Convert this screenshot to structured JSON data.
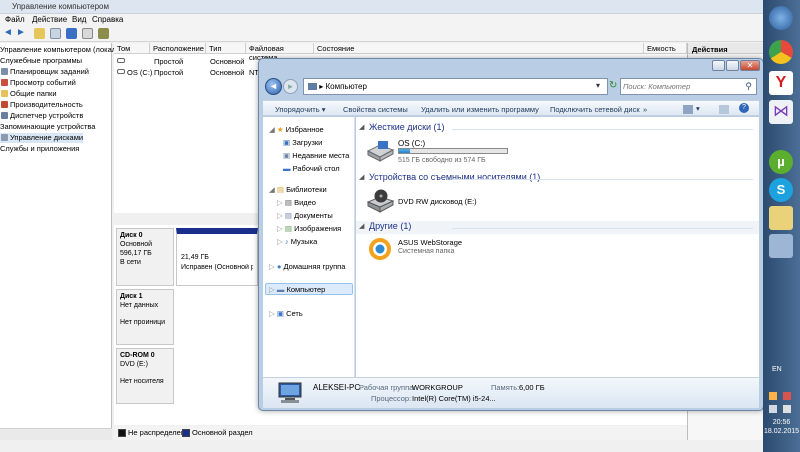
{
  "cm": {
    "title": "Управление компьютером",
    "menu": [
      "Файл",
      "Действие",
      "Вид",
      "Справка"
    ],
    "tree": [
      "Управление компьютером (локальн",
      "Служебные программы",
      "Планировщик заданий",
      "Просмотр событий",
      "Общие папки",
      "Производительность",
      "Диспетчер устройств",
      "Запоминающие устройства",
      "Управление дисками",
      "Службы и приложения"
    ],
    "columns": [
      "Том",
      "Расположение",
      "Тип",
      "Файловая система",
      "Состояние",
      "Емкость"
    ],
    "volumes": [
      {
        "name": "",
        "layout": "Простой",
        "type": "Основной",
        "fs": "",
        "status": ""
      },
      {
        "name": "OS (C:)",
        "layout": "Простой",
        "type": "Основной",
        "fs": "NT",
        "status": ""
      }
    ],
    "actions_title": "Действия",
    "disks": [
      {
        "name": "Диск 0",
        "type": "Основной",
        "size": "596,17 ГБ",
        "state": "В сети",
        "part_size": "21,49 ГБ",
        "part_status": "Исправен (Основной раз"
      },
      {
        "name": "Диск 1",
        "type": "Нет данных",
        "size": "",
        "state": "Нет проиници",
        "part_size": "",
        "part_status": ""
      },
      {
        "name": "CD-ROM 0",
        "type": "DVD (E:)",
        "size": "",
        "state": "Нет носителя",
        "part_size": "",
        "part_status": ""
      }
    ],
    "legend": [
      "Не распределен",
      "Основной раздел"
    ]
  },
  "ex": {
    "breadcrumb": "Компьютер",
    "search_placeholder": "Поиск: Компьютер",
    "commands": [
      "Упорядочить ▾",
      "Свойства системы",
      "Удалить или изменить программу",
      "Подключить сетевой диск",
      "»"
    ],
    "nav": {
      "favorites": "Избранное",
      "fav_items": [
        "Загрузки",
        "Недавние места",
        "Рабочий стол"
      ],
      "libraries": "Библиотеки",
      "lib_items": [
        "Видео",
        "Документы",
        "Изображения",
        "Музыка"
      ],
      "homegroup": "Домашняя группа",
      "computer": "Компьютер",
      "network": "Сеть"
    },
    "groups": {
      "hdd": "Жесткие диски (1)",
      "removable": "Устройства со съемными носителями (1)",
      "other": "Другие (1)"
    },
    "drive_c": {
      "name": "OS (C:)",
      "free": "515 ГБ свободно из 574 ГБ",
      "used_fraction": 0.1
    },
    "dvd": {
      "name": "DVD RW дисковод (E:)"
    },
    "asus": {
      "name": "ASUS WebStorage",
      "sub": "Системная папка"
    },
    "details": {
      "pc": "ALEKSEI-PC",
      "wg_label": "Рабочая группа:",
      "wg": "WORKGROUP",
      "mem_label": "Память:",
      "mem": "6,00 ГБ",
      "cpu_label": "Процессор:",
      "cpu": "Intel(R) Core(TM) i5-24..."
    }
  },
  "taskbar": {
    "lang": "EN",
    "time": "20:56",
    "date": "18.02.2015"
  }
}
